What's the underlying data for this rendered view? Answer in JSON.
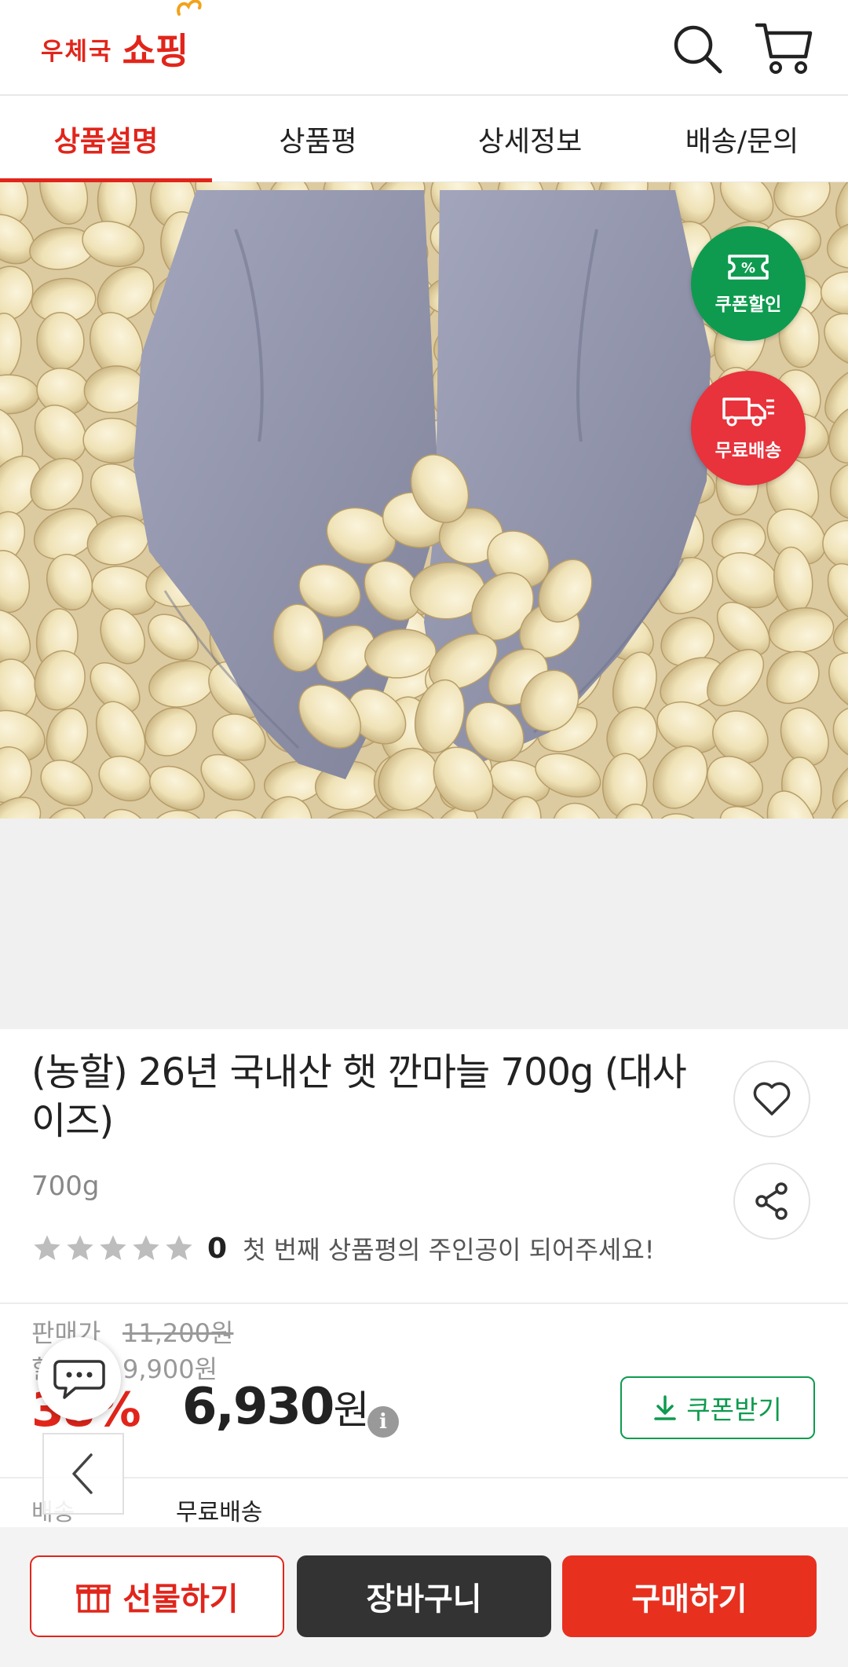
{
  "header": {
    "logo_small": "우체국",
    "logo_big": "쇼핑"
  },
  "tabs": [
    {
      "label": "상품설명"
    },
    {
      "label": "상품평"
    },
    {
      "label": "상세정보"
    },
    {
      "label": "배송/문의"
    }
  ],
  "badges": {
    "coupon": "쿠폰할인",
    "coupon_symbol": "%",
    "shipping": "무료배송"
  },
  "product": {
    "title": "(농할) 26년 국내산 햇 깐마늘 700g (대사이즈)",
    "option": "700g",
    "rating_count": "0",
    "rating_message": "첫 번째 상품평의 주인공이 되어주세요!",
    "stars_filled": 0
  },
  "price": {
    "sale_label": "판매가",
    "sale_original": "11,200원",
    "discount_label": "할",
    "discount_original": "9,900원",
    "discount_rate": "38%",
    "final": "6,930",
    "currency": "원",
    "info_icon": "i",
    "coupon_button": "쿠폰받기"
  },
  "shipping": {
    "label": "배송",
    "value": "무료배송"
  },
  "bottom_bar": {
    "gift": "선물하기",
    "cart": "장바구니",
    "buy": "구매하기"
  },
  "colors": {
    "accent": "#e1251b",
    "green": "#0e9b4f",
    "dark": "#333333"
  }
}
